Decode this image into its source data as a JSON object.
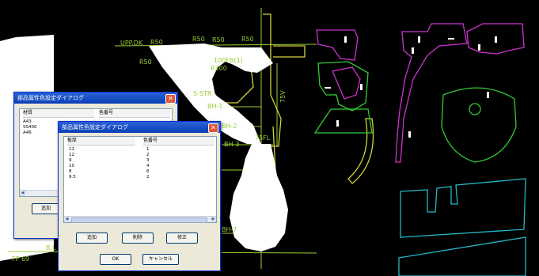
{
  "cad": {
    "labels": {
      "upp_dk": "UPP.DK",
      "r50_a": "R50",
      "r50_b": "R50",
      "r50_c": "R50",
      "r50_d": "R50",
      "r_left": "R50",
      "r300": "R300",
      "s_str": "S-STR",
      "bh1": "BH-1",
      "bh2": "BH-2",
      "bh3": "BH-3",
      "bh7": "BH-7",
      "fl75": "75FL",
      "v75": "75V",
      "bl": "B.L",
      "fp": "FP 69",
      "r300sub": "100FB(1)"
    },
    "colors": {
      "background": "#000000",
      "hull": "#ffffff",
      "guide": "#9acd32",
      "magenta": "#cc33cc",
      "yellow": "#d4d43a",
      "green": "#33cc33",
      "cyan": "#22b8c8"
    }
  },
  "dialog_back": {
    "title": "部品属性色設定ダイアログ",
    "columns": [
      "材質",
      "色番号"
    ],
    "rows": [
      [
        "A43",
        ""
      ],
      [
        "SS400",
        ""
      ],
      [
        "A46",
        ""
      ]
    ],
    "add_label": "追加"
  },
  "dialog_front": {
    "title": "部品属性色設定ダイアログ",
    "columns": [
      "板厚",
      "色番号"
    ],
    "rows": [
      [
        "11",
        "1"
      ],
      [
        "12",
        "2"
      ],
      [
        "9",
        "3"
      ],
      [
        "10",
        "4"
      ],
      [
        "8",
        "6"
      ],
      [
        "9.5",
        "2"
      ]
    ],
    "buttons": {
      "add": "追加",
      "delete": "削除",
      "modify": "修正",
      "ok": "OK",
      "cancel": "キャンセル"
    }
  }
}
